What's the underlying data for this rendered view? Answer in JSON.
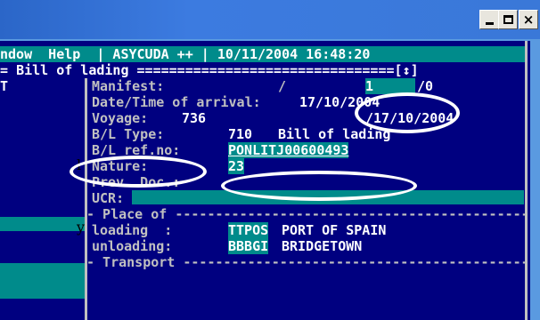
{
  "menu": {
    "items_left": "ndow  Help  ",
    "separator1": "|",
    "app_name": " ASYCUDA ++ ",
    "separator2": "|",
    "datetime": " 10/11/2004 16:48:20"
  },
  "window_title": {
    "prefix": "= ",
    "label": "Bill of lading",
    "suffix": " ================================",
    "arrows": "[↕]"
  },
  "left_pane": {
    "top_char": "T",
    "side_letter_1": "l",
    "side_letter_2": "y"
  },
  "form": {
    "manifest_label": "Manifest:",
    "manifest_slash": "/",
    "manifest_num": "1",
    "manifest_suffix": "/0",
    "arrival_label": "Date/Time of arrival:",
    "arrival_value": "17/10/2004",
    "voyage_label": "Voyage:",
    "voyage_value": "736",
    "voyage_date": "/17/10/2004",
    "bl_type_label": "B/L Type:",
    "bl_type_code": "710",
    "bl_type_desc": "Bill of lading",
    "bl_ref_label": "B/L ref.no:",
    "bl_ref_value": "PONLITJ00600493",
    "nature_label": "Nature:",
    "nature_value": "23",
    "prev_doc_label": "Prev. Doc.:",
    "ucr_label": "UCR:",
    "place_header": "- Place of -------------------------------------------------",
    "loading_label": "loading  :",
    "loading_code": "TTPOS",
    "loading_name": "PORT OF SPAIN",
    "unloading_label": "unloading:",
    "unloading_code": "BBBGI",
    "unloading_name": "BRIDGETOWN",
    "transport_header": "- Transport -------------------------------------------------"
  },
  "titlebar_buttons": {
    "minimize": "minimize-icon",
    "maximize": "maximize-icon",
    "close": "close-icon",
    "close_glyph": "×"
  }
}
